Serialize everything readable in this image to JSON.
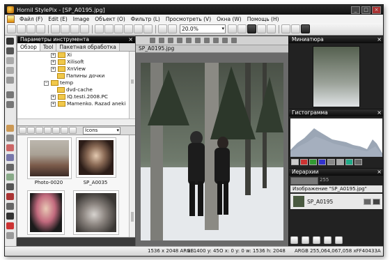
{
  "window": {
    "title": "Hornil StylePix - [SP_A0195.jpg]",
    "controls": {
      "minimize": "_",
      "maximize": "□",
      "close": "×"
    }
  },
  "menu": [
    "Файл (F)",
    "Edit (E)",
    "Image",
    "Объект (O)",
    "Фильтр (L)",
    "Просмотреть (V)",
    "Окна (W)",
    "Помощь (H)"
  ],
  "toolbar": {
    "zoom_value": "20.0%"
  },
  "tool_settings": {
    "title": "Параметры инструмента",
    "tabs": [
      "Обзор",
      "Tool",
      "Пакетная обработка"
    ],
    "tree": [
      "Xi",
      "Xilisoft",
      "XnView",
      "Папины дочки",
      "temp",
      "dvd-cache",
      "IQ.testi.2008.PC",
      "Mamenko. Razad aneki"
    ]
  },
  "browser": {
    "view_mode": "Icons",
    "thumbnails": [
      {
        "label": "Photo-0020"
      },
      {
        "label": "SP_A0035"
      },
      {
        "label": ""
      },
      {
        "label": ""
      }
    ]
  },
  "document": {
    "tab": "SP_A0195.jpg"
  },
  "panels": {
    "navigator": {
      "title": "Миниатюра"
    },
    "histogram": {
      "title": "Гистограмма"
    },
    "layers": {
      "title": "Иерархии",
      "opacity": "255",
      "image_label": "Изображение \"SP_A0195.jpg\"",
      "layer_name": "SP_A0195"
    }
  },
  "status": {
    "size": "1536 x 2048 ARGB",
    "coords": "x: 1400 y: 45",
    "offset": "O x: 0 y: 0",
    "dims": "w: 1536 h: 2048",
    "pixel": "ARGB 255,064,067,058 xFF40433A"
  },
  "colors": {
    "titlebar": "#111111",
    "panel_head": "#000000",
    "accent": "#1a6ec0"
  }
}
